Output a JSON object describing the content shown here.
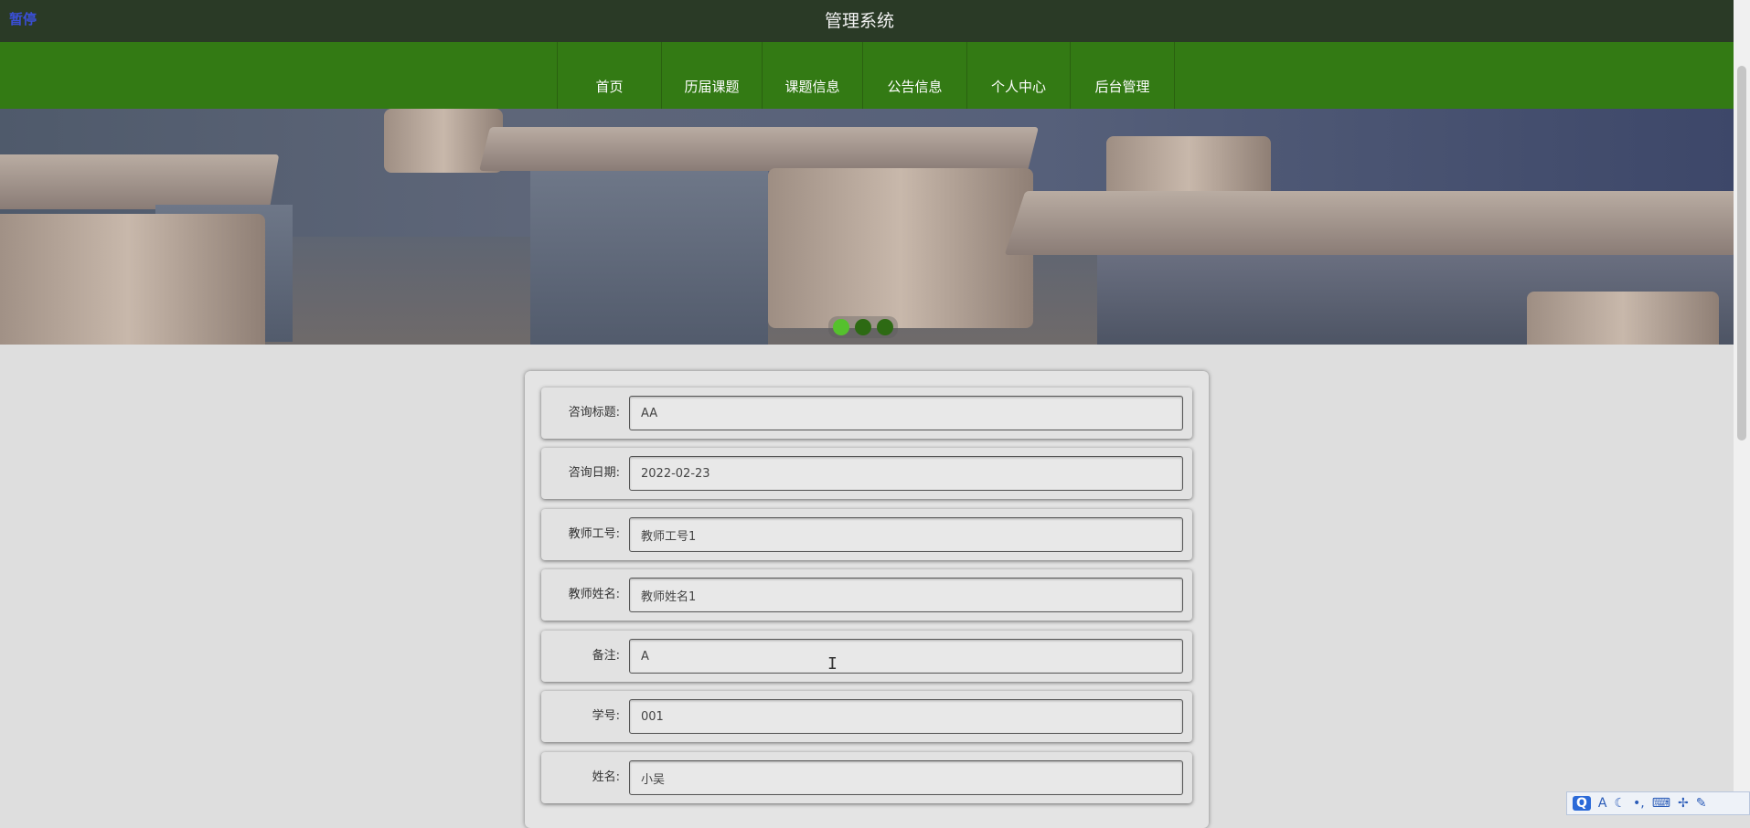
{
  "top_bar": {
    "pause_label": "暂停",
    "title": "管理系统"
  },
  "nav": {
    "items": [
      {
        "label": "首页"
      },
      {
        "label": "历届课题"
      },
      {
        "label": "课题信息"
      },
      {
        "label": "公告信息"
      },
      {
        "label": "个人中心"
      },
      {
        "label": "后台管理"
      }
    ]
  },
  "banner": {
    "image": "classroom-desks-chairs",
    "slide_count": 3,
    "active_slide": 1
  },
  "form": {
    "fields": [
      {
        "label": "咨询标题:",
        "value": "AA"
      },
      {
        "label": "咨询日期:",
        "value": "2022-02-23"
      },
      {
        "label": "教师工号:",
        "value": "教师工号1"
      },
      {
        "label": "教师姓名:",
        "value": "教师姓名1"
      },
      {
        "label": "备注:",
        "value": "A"
      },
      {
        "label": "学号:",
        "value": "001"
      },
      {
        "label": "姓名:",
        "value": "小吴"
      }
    ]
  },
  "ime_toolbar": {
    "q_label": "Q",
    "font_label": "A",
    "icons": [
      "moon-icon",
      "punctuation-icon",
      "keyboard-icon",
      "tools-icon",
      "wrench-icon"
    ]
  },
  "colors": {
    "top_bar": "#2a3a26",
    "nav_bar": "#337a14",
    "active_dot": "#55c12d",
    "page_bg": "#dedede"
  }
}
